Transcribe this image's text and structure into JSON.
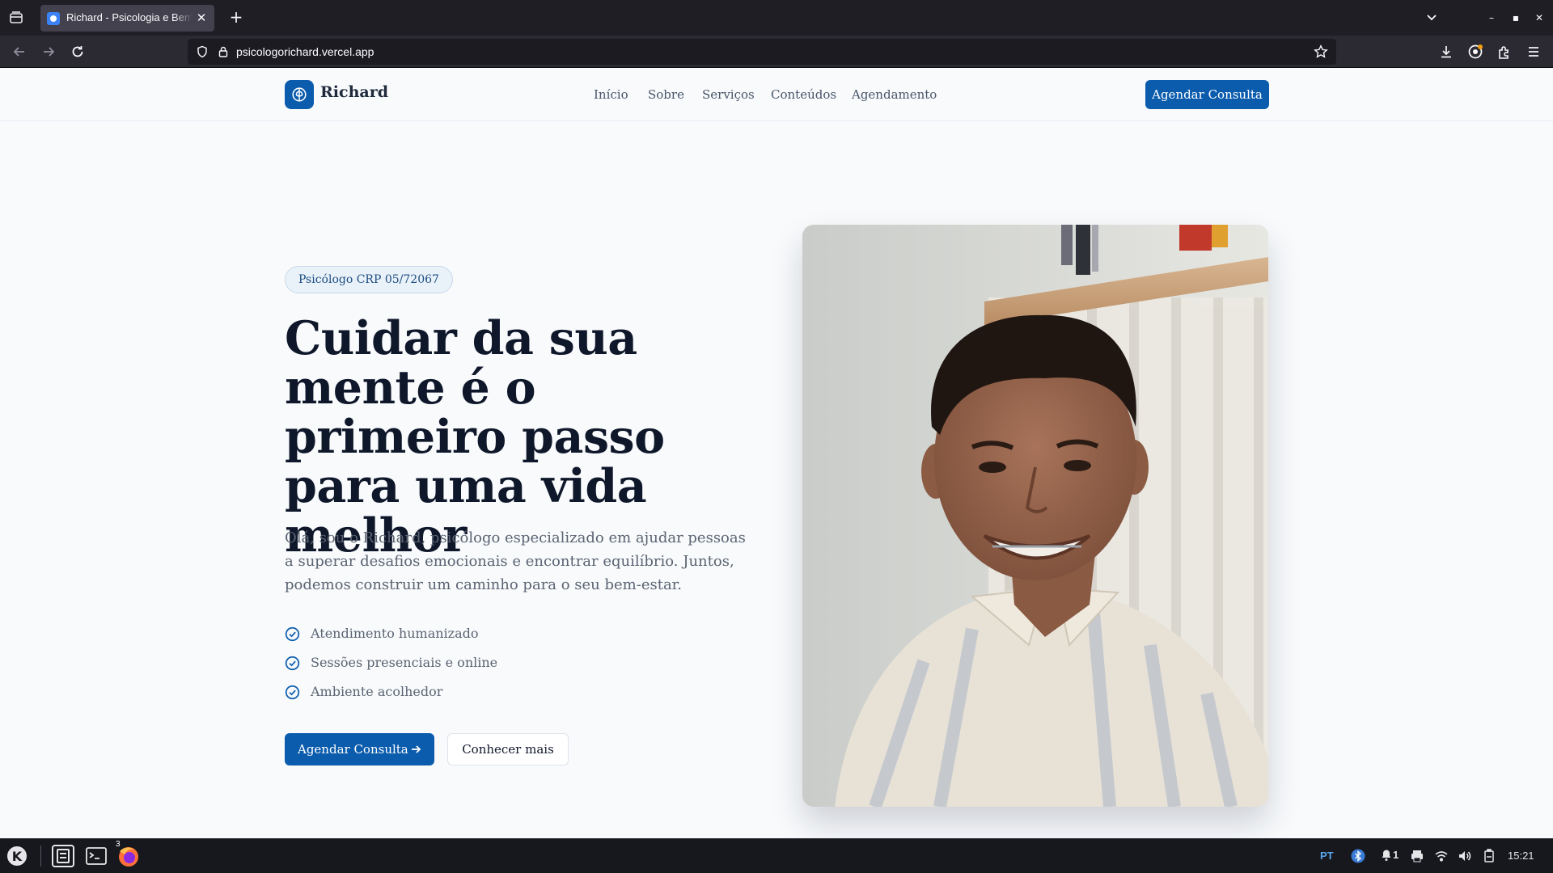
{
  "browser": {
    "tab": {
      "title": "Richard - Psicologia e Bem-Estar"
    },
    "url": "psicologorichard.vercel.app"
  },
  "site": {
    "brand": "Richard",
    "nav": [
      "Início",
      "Sobre",
      "Serviços",
      "Conteúdos",
      "Agendamento"
    ],
    "header_cta": "Agendar Consulta"
  },
  "hero": {
    "badge": "Psicólogo CRP 05/72067",
    "title": "Cuidar da sua mente é o primeiro passo para uma vida melhor",
    "description": "Olá, sou o Richard, psicólogo especializado em ajudar pessoas a superar desafios emocionais e encontrar equilíbrio. Juntos, podemos construir um caminho para o seu bem-estar.",
    "features": [
      "Atendimento humanizado",
      "Sessões presenciais e online",
      "Ambiente acolhedor"
    ],
    "primary_button": "Agendar Consulta",
    "secondary_button": "Conhecer mais"
  },
  "taskbar": {
    "firefox_badge": "3",
    "notifications_count": "1",
    "language": "PT",
    "clock": "15:21"
  },
  "colors": {
    "brand": "#0b5cad",
    "heading": "#0f172a",
    "body_text": "#5b6472",
    "page_bg": "#f8fafc",
    "browser_chrome": "#2b2a33"
  }
}
